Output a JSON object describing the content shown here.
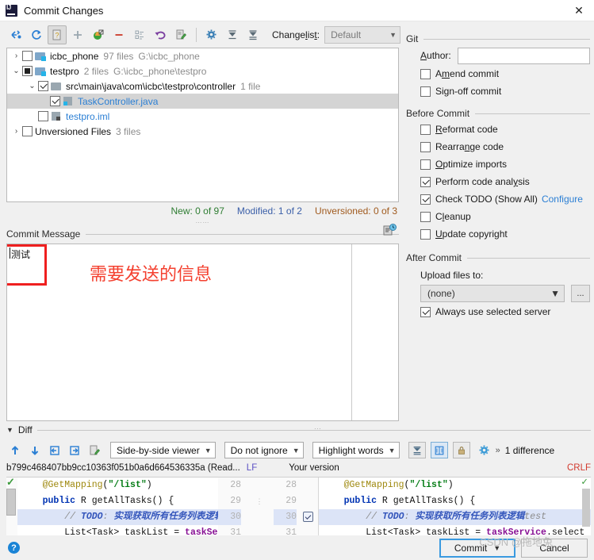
{
  "window": {
    "title": "Commit Changes",
    "app_icon": "intellij-idea-logo",
    "close_icon": "close-icon"
  },
  "toolbar": {
    "buttons": [
      {
        "name": "show-diff-icon",
        "glyph": "diff"
      },
      {
        "name": "refresh-icon",
        "glyph": "refresh"
      },
      {
        "name": "show-unversioned-icon",
        "glyph": "unversioned",
        "pressed": true
      },
      {
        "name": "add-icon",
        "glyph": "plus"
      },
      {
        "name": "move-to-changelist-icon",
        "glyph": "move"
      },
      {
        "name": "delete-icon",
        "glyph": "minus"
      },
      {
        "name": "group-by-icon",
        "glyph": "group"
      },
      {
        "name": "rollback-icon",
        "glyph": "revert"
      },
      {
        "name": "edit-source-icon",
        "glyph": "edit"
      },
      {
        "name": "settings-icon",
        "glyph": "gear"
      },
      {
        "name": "expand-all-icon",
        "glyph": "expand"
      },
      {
        "name": "collapse-all-icon",
        "glyph": "collapse"
      }
    ],
    "changelist_label": "Changelist:",
    "changelist_value": "Default"
  },
  "tree": {
    "rows": [
      {
        "twisty": "›",
        "checkbox": "unchecked",
        "icon": "folder-modified-icon",
        "name": "icbc_phone",
        "meta": "97 files",
        "path": "G:\\icbc_phone",
        "indent": 0,
        "selected": false,
        "link": false
      },
      {
        "twisty": "⌄",
        "checkbox": "partial",
        "icon": "folder-modified-icon",
        "name": "testpro",
        "meta": "2 files",
        "path": "G:\\icbc_phone\\testpro",
        "indent": 0,
        "selected": false,
        "link": false
      },
      {
        "twisty": "⌄",
        "checkbox": "checked",
        "icon": "folder-icon",
        "name": "src\\main\\java\\com\\icbc\\testpro\\controller",
        "meta": "1 file",
        "path": "",
        "indent": 1,
        "selected": false,
        "link": false
      },
      {
        "twisty": "",
        "checkbox": "checked",
        "icon": "java-file-icon",
        "name": "TaskController.java",
        "meta": "",
        "path": "",
        "indent": 2,
        "selected": true,
        "link": true
      },
      {
        "twisty": "",
        "checkbox": "unchecked",
        "icon": "iml-file-icon",
        "name": "testpro.iml",
        "meta": "",
        "path": "",
        "indent": 1,
        "selected": false,
        "link": true
      },
      {
        "twisty": "›",
        "checkbox": "unchecked",
        "icon": "",
        "name": "Unversioned Files",
        "meta": "3 files",
        "path": "",
        "indent": 0,
        "selected": false,
        "link": false
      }
    ],
    "stats": {
      "new": "New: 0 of 97",
      "modified": "Modified: 1 of 2",
      "unversioned": "Unversioned: 0 of 3",
      "new_color": "#2e7d32",
      "modified_color": "#3b5fa8",
      "unversioned_color": "#a05a1e"
    }
  },
  "commit_message": {
    "section_label": "Commit Message",
    "history_icon": "message-history-icon",
    "value": "测试",
    "annotation_text": "需要发送的信息",
    "annotation_color": "#f4402f"
  },
  "git_panel": {
    "section_label": "Git",
    "author_label": "Author:",
    "author_value": "",
    "amend_commit": "Amend commit",
    "sign_off_commit": "Sign-off commit",
    "before_commit_label": "Before Commit",
    "before_items": [
      {
        "label": "Reformat code",
        "checked": false,
        "mnemonic": "R"
      },
      {
        "label": "Rearrange code",
        "checked": false,
        "mnemonic": "n"
      },
      {
        "label": "Optimize imports",
        "checked": false,
        "mnemonic": "O"
      },
      {
        "label": "Perform code analysis",
        "checked": true,
        "mnemonic": "y"
      },
      {
        "label": "Check TODO (Show All)",
        "checked": true,
        "link": "Configure"
      },
      {
        "label": "Cleanup",
        "checked": false,
        "mnemonic": "l"
      },
      {
        "label": "Update copyright",
        "checked": false,
        "mnemonic": "U"
      }
    ],
    "after_commit_label": "After Commit",
    "upload_label": "Upload files to:",
    "upload_value": "(none)",
    "ellipsis_button": "...",
    "always_use_server": "Always use selected server",
    "always_use_server_checked": true
  },
  "diff": {
    "section_label": "Diff",
    "toolbar_icons": [
      {
        "name": "previous-difference-icon",
        "glyph": "↑",
        "color": "#2b7fd4"
      },
      {
        "name": "next-difference-icon",
        "glyph": "↓",
        "color": "#2b7fd4"
      },
      {
        "name": "accept-left-icon",
        "glyph": "left"
      },
      {
        "name": "accept-right-icon",
        "glyph": "right"
      },
      {
        "name": "edit-source-icon",
        "glyph": "edit"
      }
    ],
    "viewer_mode": "Side-by-side viewer",
    "ignore_mode": "Do not ignore",
    "highlight_mode": "Highlight words",
    "collapse_icon": "collapse-unchanged-icon",
    "whitespace_icon": "show-whitespace-icon",
    "lock_icon": "lock-icon",
    "settings_icon": "gear-icon",
    "more_chevron": "»",
    "difference_count": "1 difference",
    "left_revision": "b799c468407bb9cc10363f051b0a6d664536335a (Read...",
    "left_line_ending": "LF",
    "right_title": "Your version",
    "right_line_ending": "CRLF",
    "left_lines": [
      {
        "num": "28",
        "tokens": [
          {
            "t": "    ",
            "c": "plain"
          },
          {
            "t": "@GetMapping",
            "c": "ann"
          },
          {
            "t": "(",
            "c": "plain"
          },
          {
            "t": "\"/list\"",
            "c": "str"
          },
          {
            "t": ")",
            "c": "plain"
          }
        ],
        "hl": false
      },
      {
        "num": "29",
        "tokens": [
          {
            "t": "    ",
            "c": "plain"
          },
          {
            "t": "public",
            "c": "kw"
          },
          {
            "t": " R getAllTasks() {",
            "c": "plain"
          }
        ],
        "hl": false
      },
      {
        "num": "30",
        "tokens": [
          {
            "t": "        ",
            "c": "plain"
          },
          {
            "t": "// ",
            "c": "cmt"
          },
          {
            "t": "TODO",
            "c": "todo"
          },
          {
            "t": ": ",
            "c": "cmt"
          },
          {
            "t": "实现获取所有任务列表逻辑",
            "c": "todo"
          },
          {
            "t": "test",
            "c": "cmt"
          }
        ],
        "hl": true
      },
      {
        "num": "31",
        "tokens": [
          {
            "t": "        List<Task> taskList = ",
            "c": "plain"
          },
          {
            "t": "taskService",
            "c": "fld"
          },
          {
            "t": ".sel",
            "c": "plain"
          }
        ],
        "hl": false
      }
    ],
    "right_lines": [
      {
        "num": "28",
        "tokens": [
          {
            "t": "    ",
            "c": "plain"
          },
          {
            "t": "@GetMapping",
            "c": "ann"
          },
          {
            "t": "(",
            "c": "plain"
          },
          {
            "t": "\"/list\"",
            "c": "str"
          },
          {
            "t": ")",
            "c": "plain"
          }
        ],
        "hl": false
      },
      {
        "num": "29",
        "tokens": [
          {
            "t": "    ",
            "c": "plain"
          },
          {
            "t": "public",
            "c": "kw"
          },
          {
            "t": " R getAllTasks() {",
            "c": "plain"
          }
        ],
        "hl": false
      },
      {
        "num": "30",
        "tokens": [
          {
            "t": "        ",
            "c": "plain"
          },
          {
            "t": "// ",
            "c": "cmt"
          },
          {
            "t": "TODO",
            "c": "todo"
          },
          {
            "t": ": ",
            "c": "cmt"
          },
          {
            "t": "实现获取所有任务列表逻辑",
            "c": "todo"
          },
          {
            "t": "test",
            "c": "cmt"
          }
        ],
        "hl": true
      },
      {
        "num": "31",
        "tokens": [
          {
            "t": "        List<Task> taskList = ",
            "c": "plain"
          },
          {
            "t": "taskService",
            "c": "fld"
          },
          {
            "t": ".select",
            "c": "plain"
          }
        ],
        "hl": false
      }
    ]
  },
  "footer": {
    "help_icon": "help-icon",
    "commit_label": "Commit",
    "commit_dropdown_icon": "chevron-down-icon",
    "cancel_label": "Cancel",
    "watermark": "CSDN @拖地兔"
  }
}
